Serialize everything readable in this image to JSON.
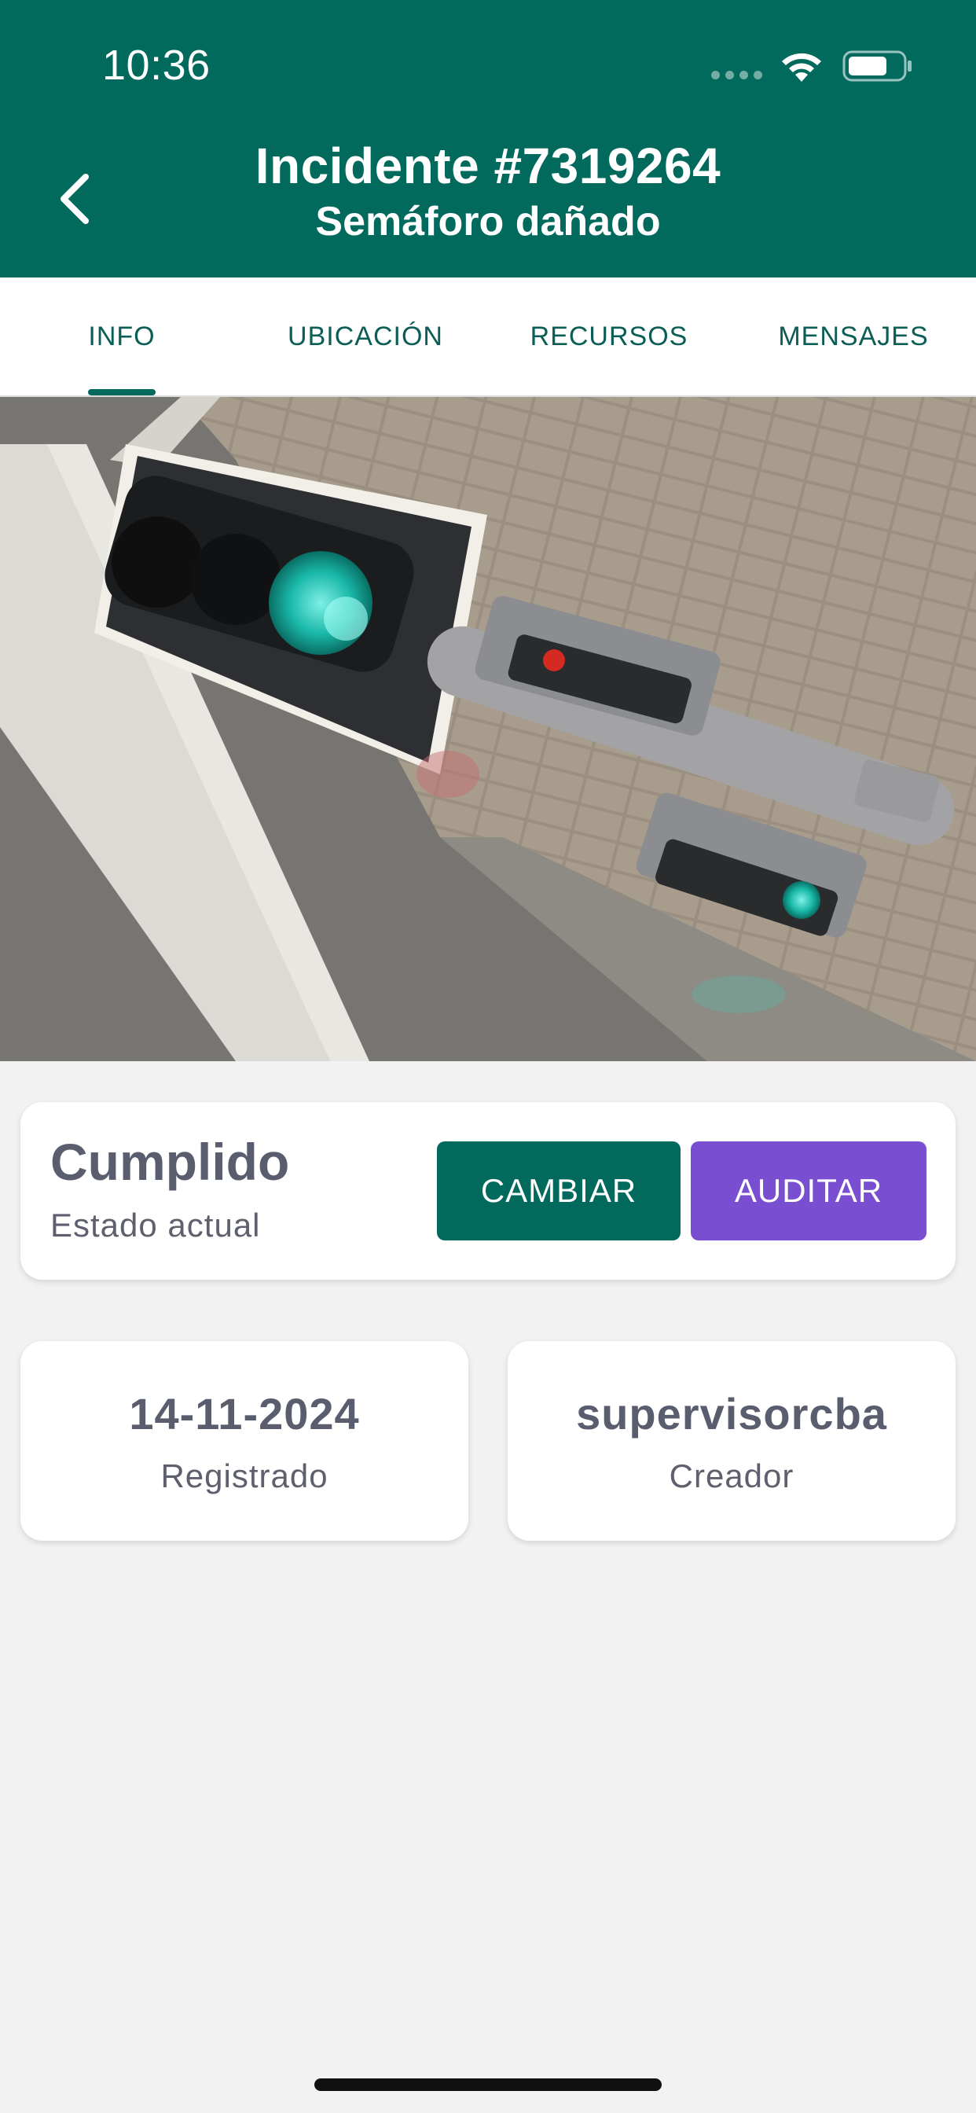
{
  "status_bar": {
    "time": "10:36"
  },
  "header": {
    "title": "Incidente #7319264",
    "subtitle": "Semáforo dañado",
    "back_icon": "chevron-left-icon"
  },
  "tabs": [
    {
      "label": "INFO",
      "active": true
    },
    {
      "label": "UBICACIÓN",
      "active": false
    },
    {
      "label": "RECURSOS",
      "active": false
    },
    {
      "label": "MENSAJES",
      "active": false
    }
  ],
  "status": {
    "value": "Cumplido",
    "label": "Estado actual",
    "change_button": "CAMBIAR",
    "audit_button": "AUDITAR"
  },
  "registered": {
    "value": "14-11-2024",
    "label": "Registrado"
  },
  "creator": {
    "value": "supervisorcba",
    "label": "Creador"
  },
  "colors": {
    "primary": "#02695d",
    "audit": "#7a4ed1",
    "background": "#f2f2f2",
    "card_text": "#5a5d6d"
  }
}
